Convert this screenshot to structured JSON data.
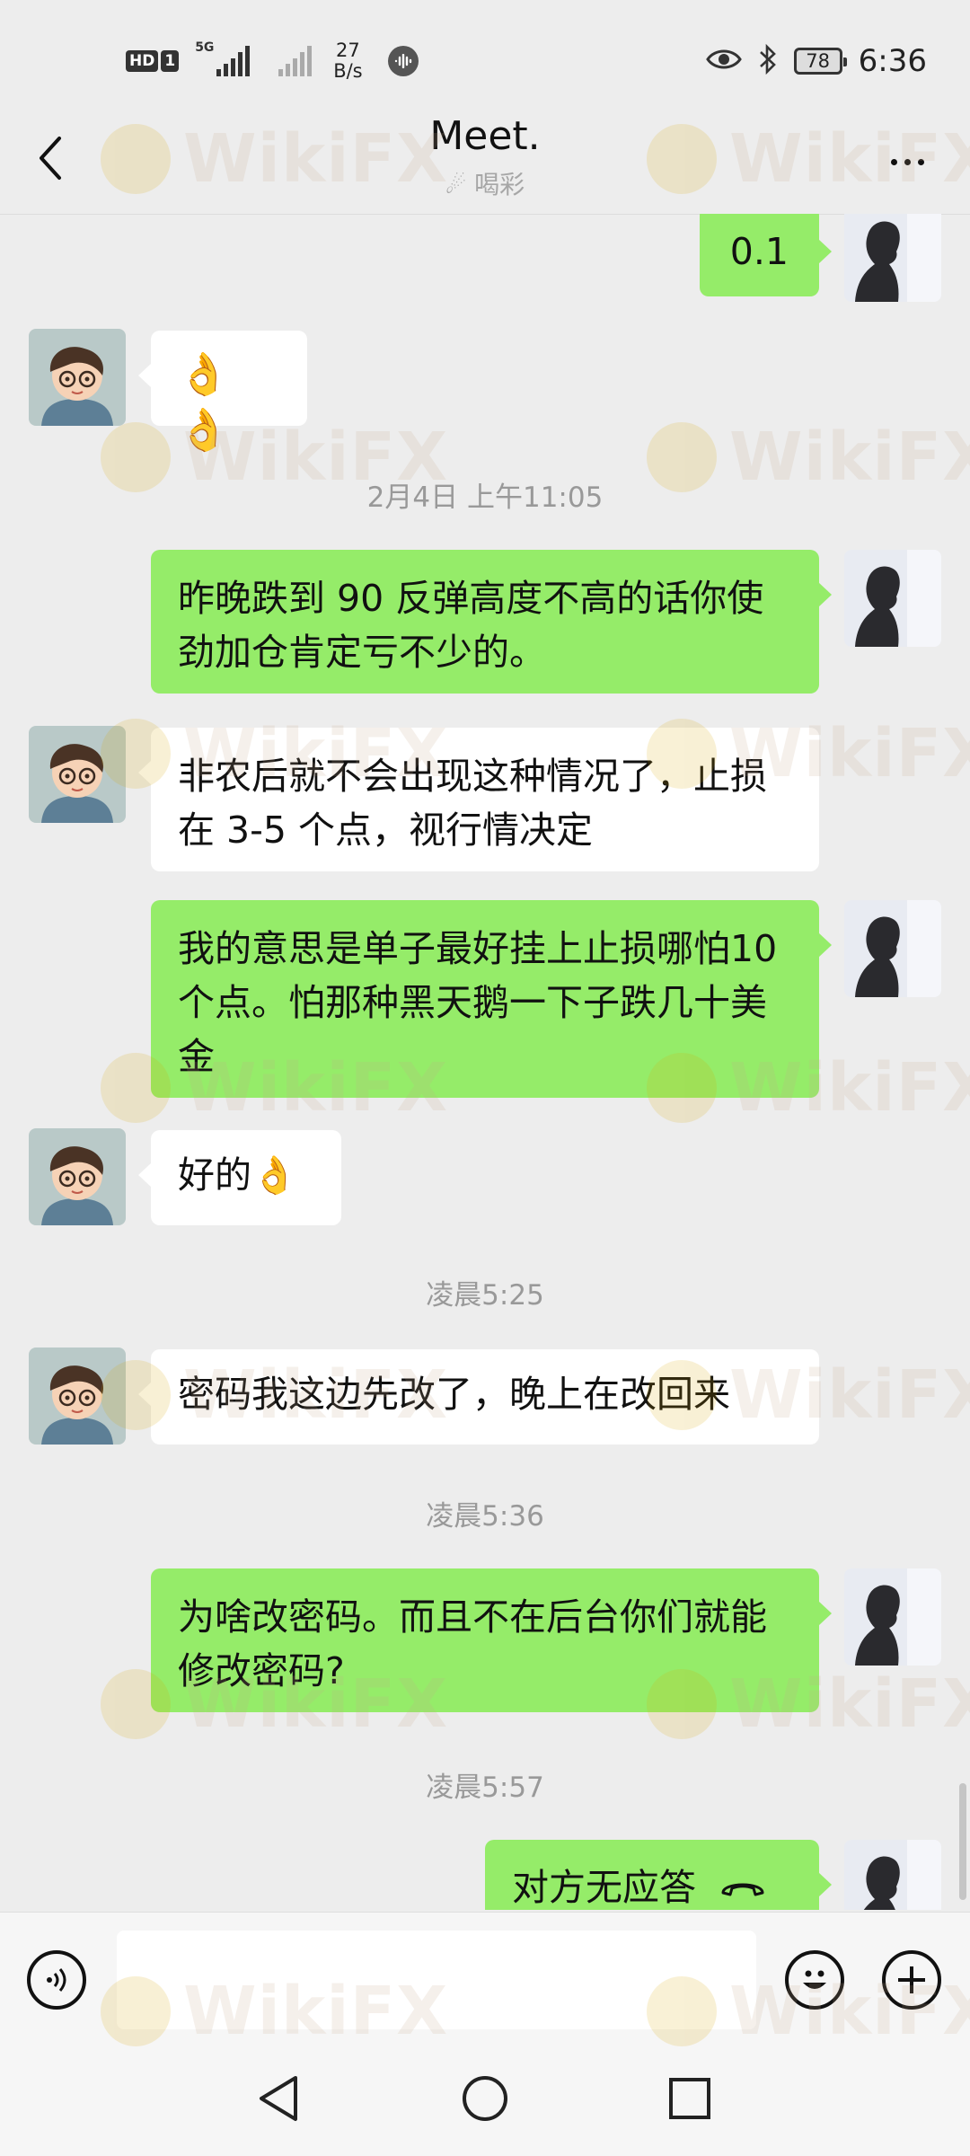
{
  "status_bar": {
    "hd_labels": [
      "HD",
      "1"
    ],
    "net_label": "5G",
    "speed_value": "27",
    "speed_unit": "B/s",
    "battery": "78",
    "time": "6:36"
  },
  "header": {
    "title": "Meet.",
    "subtitle": "喝彩"
  },
  "messages": [
    {
      "type": "sent",
      "text": "0.1"
    },
    {
      "type": "received",
      "text": "👌👌"
    },
    {
      "type": "timestamp",
      "text": "2月4日 上午11:05"
    },
    {
      "type": "sent",
      "text": "昨晚跌到 90 反弹高度不高的话你使劲加仓肯定亏不少的。"
    },
    {
      "type": "received",
      "text": "非农后就不会出现这种情况了，止损在 3-5 个点，视行情决定"
    },
    {
      "type": "sent",
      "text": "我的意思是单子最好挂上止损哪怕10 个点。怕那种黑天鹅一下子跌几十美金"
    },
    {
      "type": "received",
      "text": "好的👌"
    },
    {
      "type": "timestamp",
      "text": "凌晨5:25"
    },
    {
      "type": "received",
      "text": "密码我这边先改了，晚上在改回来"
    },
    {
      "type": "timestamp",
      "text": "凌晨5:36"
    },
    {
      "type": "sent",
      "text": "为啥改密码。而且不在后台你们就能修改密码?"
    },
    {
      "type": "timestamp",
      "text": "凌晨5:57"
    },
    {
      "type": "sent",
      "text": "对方无应答"
    }
  ],
  "input": {
    "value": ""
  },
  "watermark": "WikiFX",
  "icons": {
    "back": "back-arrow-icon",
    "more": "more-dots-icon",
    "voice": "voice-icon",
    "emoji": "emoji-icon",
    "plus": "plus-icon",
    "call": "phone-hangup-icon",
    "nav_back": "nav-back-icon",
    "nav_home": "nav-home-icon",
    "nav_recent": "nav-recent-icon"
  },
  "colors": {
    "sent_bubble": "#95ec69",
    "received_bubble": "#ffffff",
    "background": "#ededed"
  }
}
